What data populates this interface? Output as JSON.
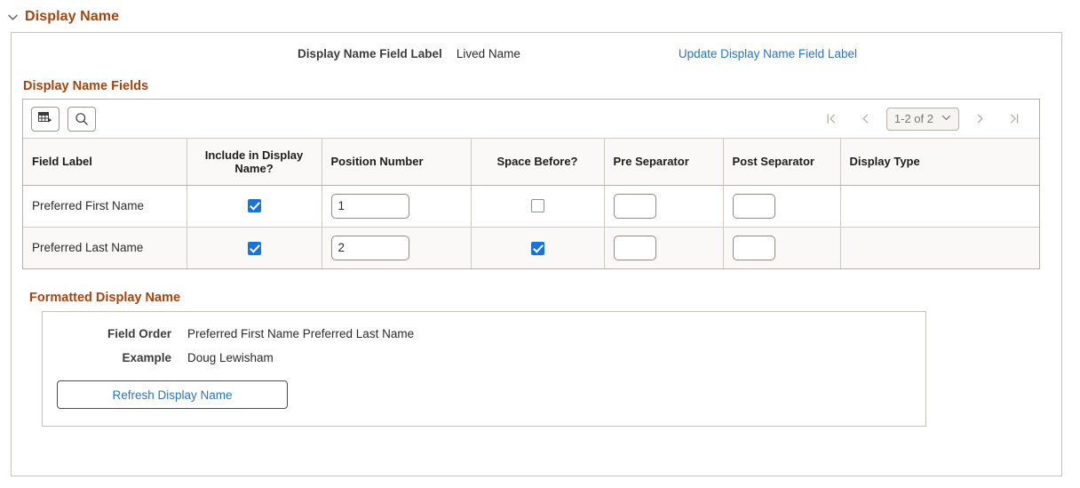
{
  "section": {
    "title": "Display Name",
    "collapse_icon": "chevron-down-icon",
    "expanded": true
  },
  "header_fields": {
    "display_name_field_label_label": "Display Name Field Label",
    "display_name_field_label_value": "Lived Name",
    "update_link": "Update Display Name Field Label"
  },
  "display_name_fields": {
    "group_title": "Display Name Fields",
    "toolbar": {
      "personalize_icon": "grid-personalize-icon",
      "search_icon": "search-icon"
    },
    "pagination": {
      "first_icon": "first-page-icon",
      "prev_icon": "previous-page-icon",
      "range": "1-2 of 2",
      "dropdown_icon": "chevron-down-icon",
      "next_icon": "next-page-icon",
      "last_icon": "last-page-icon"
    },
    "columns": [
      "Field Label",
      "Include in Display Name?",
      "Position Number",
      "Space Before?",
      "Pre Separator",
      "Post Separator",
      "Display Type"
    ],
    "rows": [
      {
        "field_label": "Preferred First Name",
        "include_in_display_name": true,
        "position_number": "1",
        "space_before": false,
        "pre_separator": "",
        "post_separator": "",
        "display_type": ""
      },
      {
        "field_label": "Preferred Last Name",
        "include_in_display_name": true,
        "position_number": "2",
        "space_before": true,
        "pre_separator": "",
        "post_separator": "",
        "display_type": ""
      }
    ]
  },
  "formatted_display_name": {
    "group_title": "Formatted Display Name",
    "field_order_label": "Field Order",
    "field_order_value": "Preferred First Name Preferred Last Name",
    "example_label": "Example",
    "example_value": "Doug Lewisham",
    "refresh_button": "Refresh Display Name"
  },
  "colors": {
    "section_heading": "#A34411",
    "link": "#2b73c4",
    "checkbox_checked": "#1a73d9",
    "panel_border": "#c8c2ba",
    "row_alt_bg": "#faf9f7"
  }
}
